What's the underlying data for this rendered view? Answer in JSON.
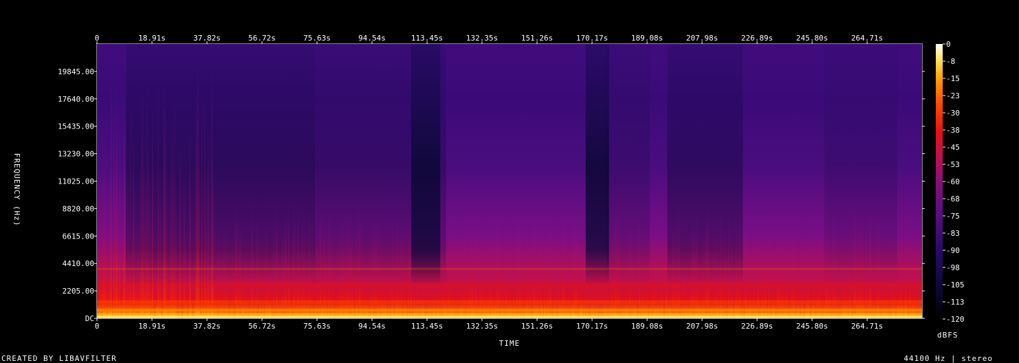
{
  "chart_data": {
    "type": "heatmap",
    "xlabel": "TIME",
    "ylabel": "FREQUENCY (Hz)",
    "x_ticks": [
      "0",
      "18.91s",
      "37.82s",
      "56.72s",
      "75.63s",
      "94.54s",
      "113.45s",
      "132.35s",
      "151.26s",
      "170.17s",
      "189.08s",
      "207.98s",
      "226.89s",
      "245.80s",
      "264.71s"
    ],
    "x_tick_values": [
      0,
      18.91,
      37.82,
      56.72,
      75.63,
      94.54,
      113.45,
      132.35,
      151.26,
      170.17,
      189.08,
      207.98,
      226.89,
      245.8,
      264.71
    ],
    "xlim": [
      0,
      283.6
    ],
    "y_ticks": [
      "DC",
      "2205.00",
      "4410.00",
      "6615.00",
      "8820.00",
      "11025.00",
      "13230.00",
      "15435.00",
      "17640.00",
      "19845.00"
    ],
    "y_tick_values": [
      0,
      2205,
      4410,
      6615,
      8820,
      11025,
      13230,
      15435,
      17640,
      19845
    ],
    "ylim": [
      0,
      22050
    ],
    "colorbar": {
      "label": "dBFS",
      "ticks": [
        "0",
        "-8",
        "-15",
        "-23",
        "-30",
        "-38",
        "-45",
        "-53",
        "-60",
        "-68",
        "-75",
        "-83",
        "-90",
        "-98",
        "-105",
        "-113",
        "-120"
      ],
      "range": [
        -120,
        0
      ]
    },
    "grid": false,
    "footer_left": "CREATED BY LIBAVFILTER",
    "footer_right": "44100 Hz | stereo"
  }
}
